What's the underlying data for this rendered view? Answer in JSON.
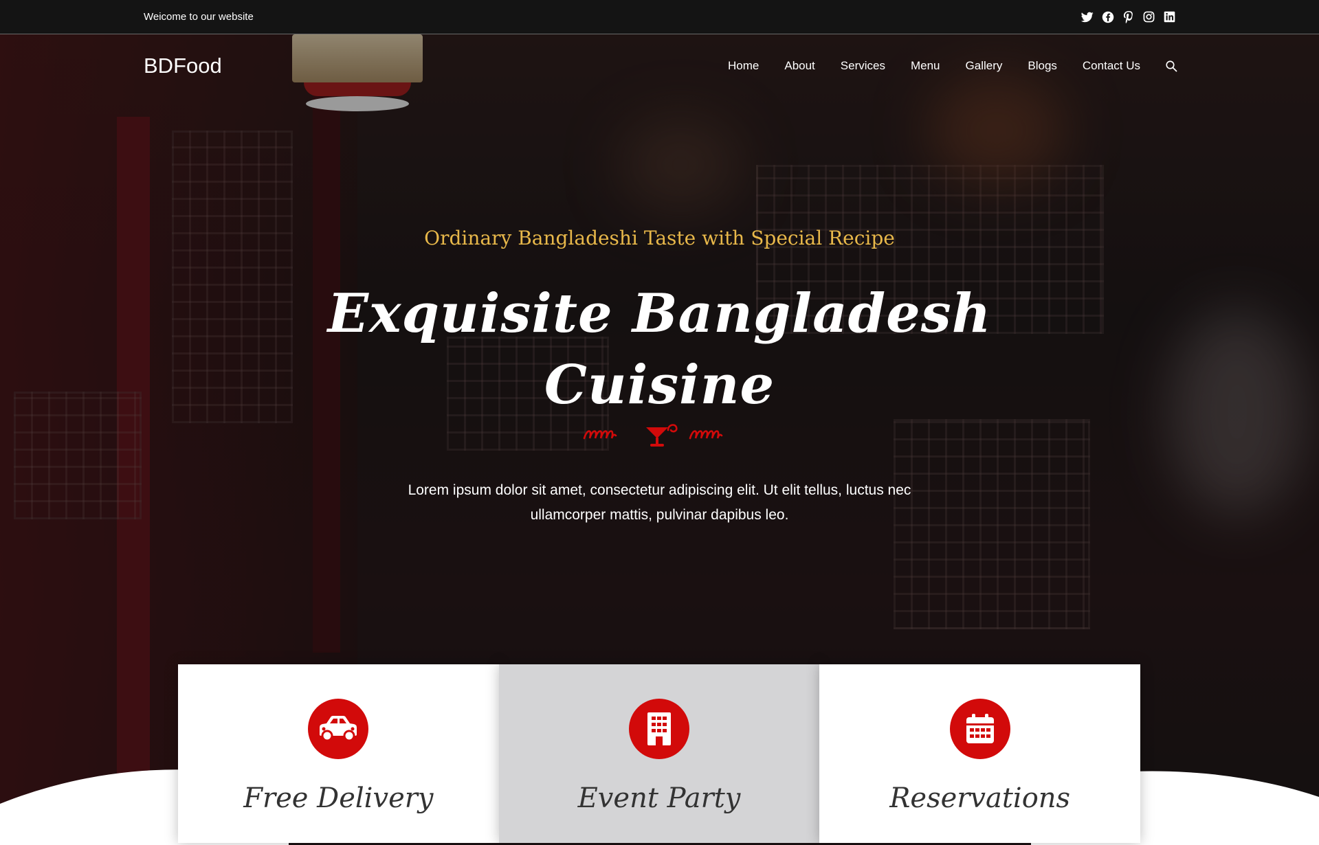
{
  "topbar": {
    "welcome": "Weicome to our website",
    "social": [
      "twitter-icon",
      "facebook-icon",
      "pinterest-icon",
      "instagram-icon",
      "linkedin-icon"
    ]
  },
  "header": {
    "logo": "BDFood",
    "nav": [
      "Home",
      "About",
      "Services",
      "Menu",
      "Gallery",
      "Blogs",
      "Contact Us"
    ],
    "search_icon": "search-icon"
  },
  "hero": {
    "subtitle": "Ordinary Bangladeshi Taste with Special Recipe",
    "title_line1": "Exquisite Bangladesh",
    "title_line2": "Cuisine",
    "description_line1": "Lorem ipsum dolor sit amet, consectetur adipiscing elit. Ut elit tellus, luctus nec",
    "description_line2": "ullamcorper mattis, pulvinar dapibus leo."
  },
  "features": [
    {
      "label": "Free Delivery",
      "icon": "car-icon"
    },
    {
      "label": "Event Party",
      "icon": "building-icon"
    },
    {
      "label": "Reservations",
      "icon": "calendar-icon"
    }
  ],
  "colors": {
    "accent": "#d20a0a",
    "subtitle": "#e8b84a",
    "topbar": "#141414"
  }
}
